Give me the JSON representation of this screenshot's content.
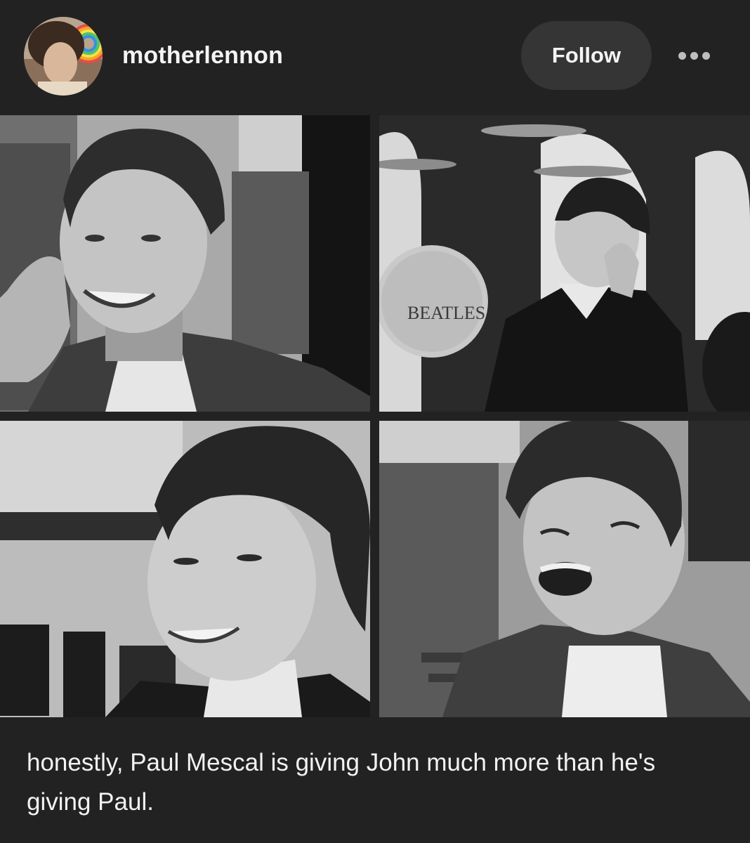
{
  "post": {
    "username": "motherlennon",
    "follow_label": "Follow",
    "more_icon": "more-horizontal-icon",
    "caption": "honestly, Paul Mescal is giving John much more than he's giving Paul."
  },
  "photos": [
    {
      "subject": "young man smiling with hand on phone, denim jacket"
    },
    {
      "subject": "drum kit and laughing musician on stage"
    },
    {
      "subject": "musician with mop-top haircut smiling in profile"
    },
    {
      "subject": "young man laughing with eyes closed, denim jacket"
    }
  ],
  "avatar": {
    "ring_colors": [
      "#e84a4a",
      "#f6a623",
      "#f5e04b",
      "#4cc46a",
      "#3a8ee6",
      "#9b59d6"
    ]
  },
  "drum_text": "BEATLES"
}
